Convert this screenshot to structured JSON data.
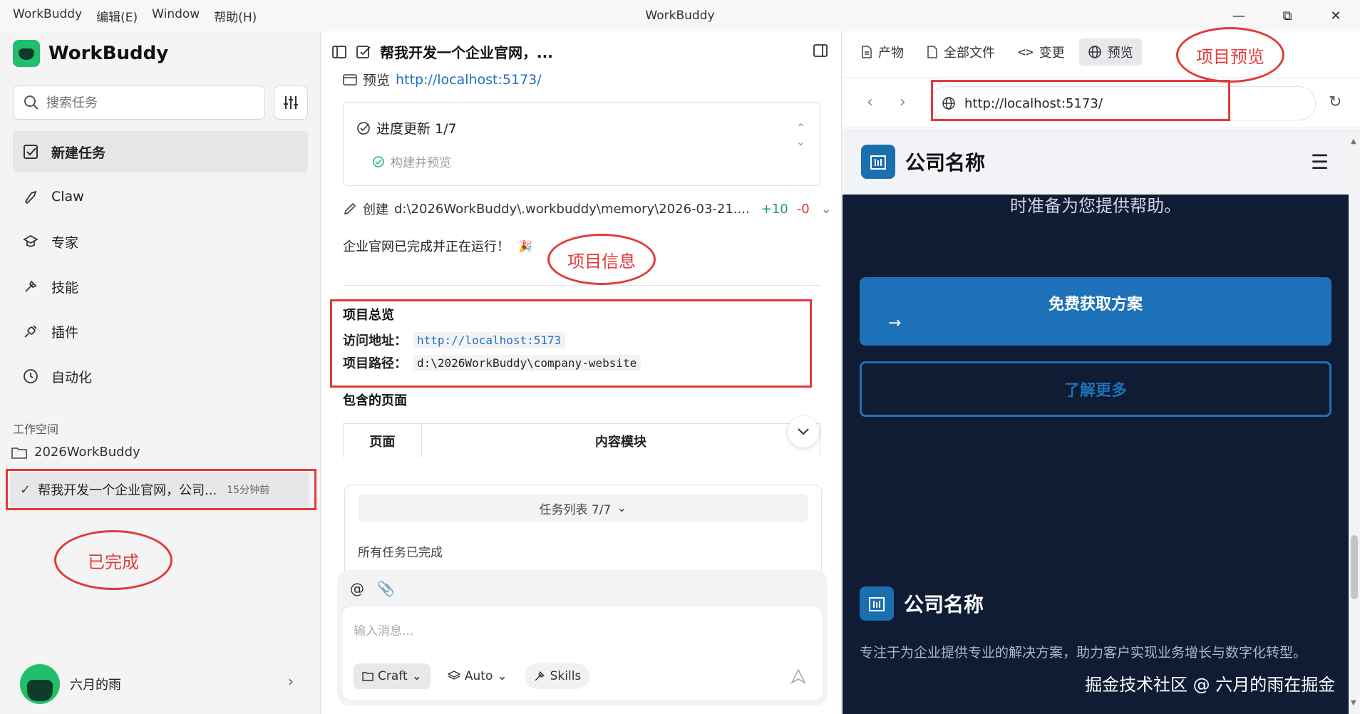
{
  "titlebar": {
    "menu": [
      "WorkBuddy",
      "编辑(E)",
      "Window",
      "帮助(H)"
    ],
    "title": "WorkBuddy"
  },
  "sidebar": {
    "brand": "WorkBuddy",
    "search_placeholder": "搜索任务",
    "nav": [
      {
        "label": "新建任务",
        "icon": "new-task-icon"
      },
      {
        "label": "Claw",
        "icon": "claw-icon"
      },
      {
        "label": "专家",
        "icon": "expert-icon"
      },
      {
        "label": "技能",
        "icon": "skill-icon"
      },
      {
        "label": "插件",
        "icon": "plugin-icon"
      },
      {
        "label": "自动化",
        "icon": "clock-icon"
      }
    ],
    "workspace_label": "工作空间",
    "workspace_folder": "2026WorkBuddy",
    "task": {
      "title": "帮我开发一个企业官网，公司...",
      "time": "15分钟前"
    },
    "user": "六月的雨"
  },
  "annotations": {
    "completed": "已完成",
    "project_info": "项目信息",
    "project_preview": "项目预览"
  },
  "chat": {
    "title": "帮我开发一个企业官网，...",
    "preview_label": "预览",
    "preview_url": "http://localhost:5173/",
    "progress": {
      "title": "进度更新 1/7",
      "step": "构建并预览"
    },
    "create": {
      "label": "创建",
      "path": "d:\\2026WorkBuddy\\.workbuddy\\memory\\2026-03-21....",
      "plus": "+10",
      "minus": "-0"
    },
    "done_message": "企业官网已完成并正在运行！",
    "overview": {
      "title": "项目总览",
      "url_label": "访问地址：",
      "url": "http://localhost:5173",
      "path_label": "项目路径：",
      "path": "d:\\2026WorkBuddy\\company-website"
    },
    "pages_title": "包含的页面",
    "table_headers": [
      "页面",
      "内容模块"
    ],
    "tasklist": {
      "head": "任务列表 7/7",
      "body": "所有任务已完成"
    },
    "composer": {
      "placeholder": "输入消息...",
      "craft": "Craft",
      "auto": "Auto",
      "skills": "Skills"
    }
  },
  "preview": {
    "tabs": [
      "产物",
      "全部文件",
      "变更",
      "预览"
    ],
    "url": "http://localhost:5173/",
    "site_name": "公司名称",
    "hero_text": "时准备为您提供帮助。",
    "cta_primary": "免费获取方案",
    "cta_secondary": "了解更多",
    "footer_name": "公司名称",
    "footer_desc": "专注于为企业提供专业的解决方案，助力客户实现业务增长与数字化转型。",
    "watermark": "掘金技术社区 @ 六月的雨在掘金"
  },
  "colors": {
    "accent": "#1d71b8",
    "annotation": "#e23a3a",
    "site_bg": "#101b34",
    "brand_green": "#1fbf6c"
  }
}
